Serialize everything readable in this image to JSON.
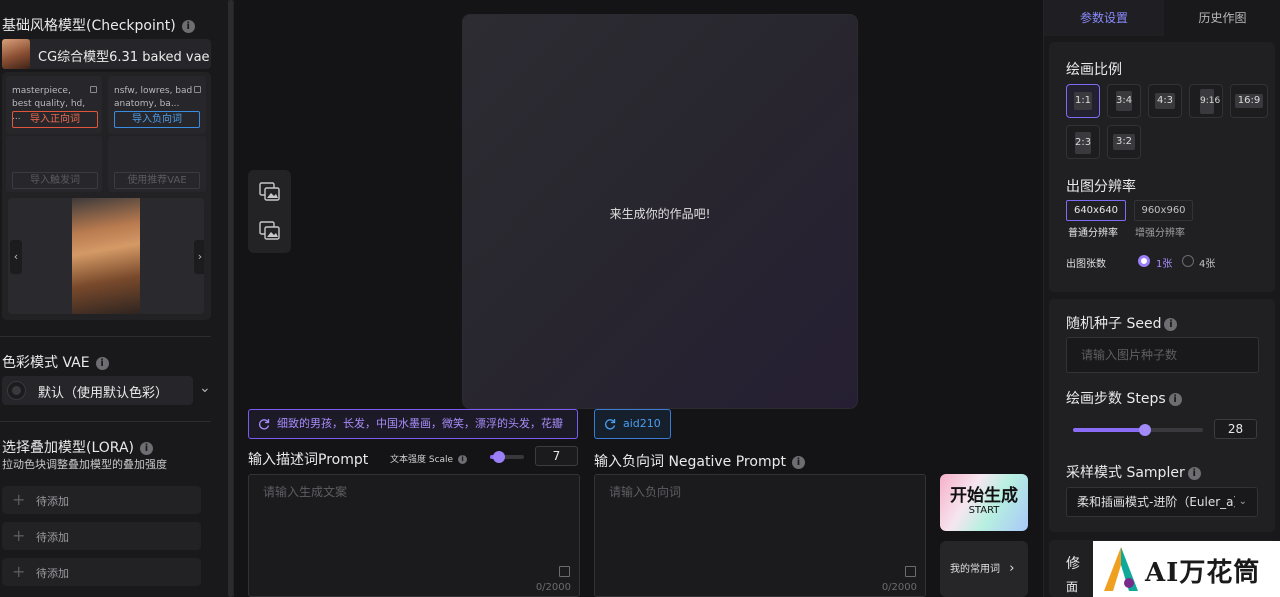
{
  "left": {
    "checkpoint_title": "基础风格模型(Checkpoint)",
    "info_glyph": "i",
    "model_name": "CG综合模型6.31 baked vae",
    "positive_prompt_preview": "masterpiece, best quality, hd, ...",
    "negative_prompt_preview": "nsfw, lowres, bad anatomy, ba...",
    "import_positive": "导入正向词",
    "import_negative": "导入负向词",
    "import_trigger": "导入触发词",
    "use_recommended_vae": "使用推荐VAE",
    "prev_glyph": "‹",
    "next_glyph": "›",
    "vae_title": "色彩模式 VAE",
    "vae_value": "默认（使用默认色彩）",
    "chevron_glyph": "⌄",
    "lora_title": "选择叠加模型(LORA)",
    "lora_subtitle": "拉动色块调整叠加模型的叠加强度",
    "lora_plus": "+",
    "lora_slots": [
      "待添加",
      "待添加",
      "待添加"
    ]
  },
  "center": {
    "canvas_hint": "来生成你的作品吧!",
    "prompt_tag": "细致的男孩，长发，中国水墨画，微笑，漂浮的头发，花瓣",
    "negative_tag": "aid210",
    "prompt_title": "输入描述词Prompt",
    "scale_label": "文本强度 Scale",
    "scale_value": "7",
    "scale_fraction": 0.25,
    "negative_title": "输入负向词 Negative Prompt",
    "prompt_placeholder": "请输入生成文案",
    "negative_placeholder": "请输入负向词",
    "prompt_count": "0/2000",
    "negative_count": "0/2000",
    "start_main": "开始生成",
    "start_sub": "START",
    "common_words": "我的常用词",
    "common_chevron": "›"
  },
  "right": {
    "tab_params": "参数设置",
    "tab_history": "历史作图",
    "ratio_title": "绘画比例",
    "ratios": [
      "1:1",
      "3:4",
      "4:3",
      "9:16",
      "16:9",
      "2:3",
      "3:2"
    ],
    "resolution_title": "出图分辨率",
    "res_normal_value": "640x640",
    "res_high_value": "960x960",
    "res_normal_label": "普通分辨率",
    "res_high_label": "增强分辨率",
    "count_label": "出图张数",
    "count_one": "1张",
    "count_four": "4张",
    "seed_title": "随机种子 Seed",
    "seed_placeholder": "请输入图片种子数",
    "steps_title": "绘画步数 Steps",
    "steps_value": "28",
    "steps_fraction": 0.55,
    "sampler_title": "采样模式 Sampler",
    "sampler_value": "柔和插画模式-进阶（Euler_a）",
    "more_card_char_1": "修",
    "more_card_char_2": "面"
  },
  "watermark": {
    "text": "AI万花筒"
  },
  "colors": {
    "accent_purple": "#8b6cf6",
    "accent_blue": "#4b9df0",
    "accent_red": "#f06a4f",
    "background": "#141416"
  }
}
